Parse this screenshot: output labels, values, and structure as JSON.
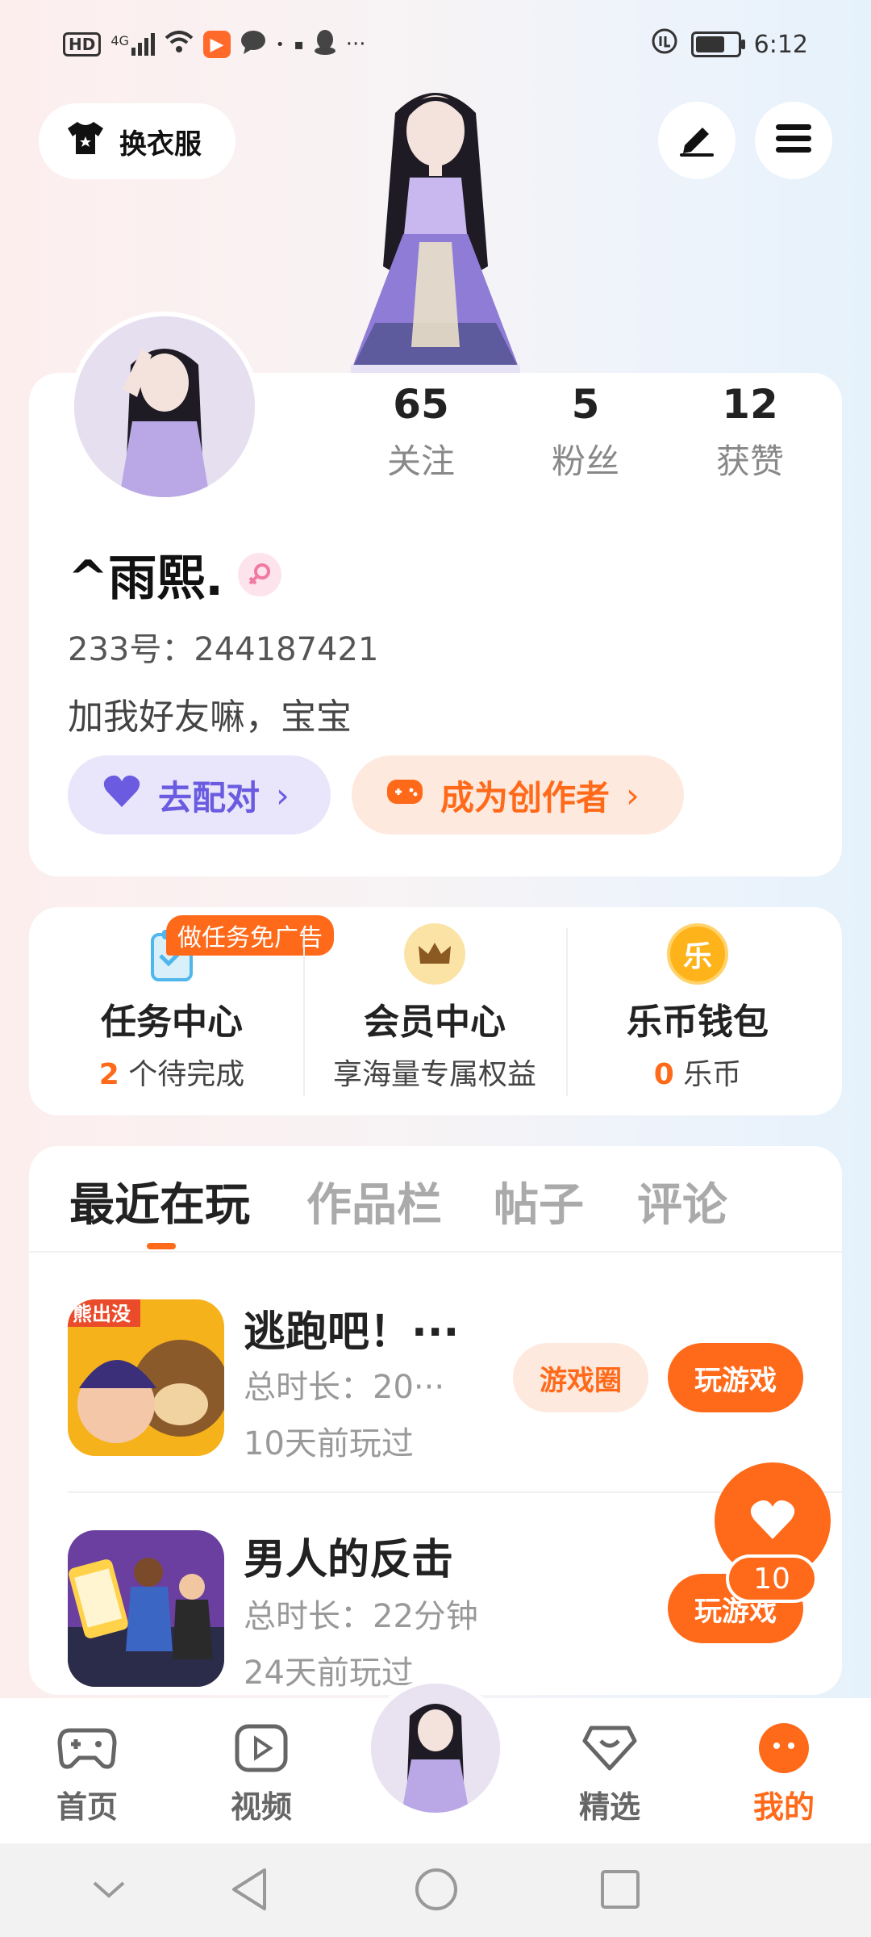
{
  "status_bar": {
    "hd": "HD",
    "network": "4G",
    "more": "···",
    "time": "6:12",
    "battery_level": 0.7
  },
  "top": {
    "outfit_label": "换衣服"
  },
  "profile": {
    "stats": [
      {
        "value": "65",
        "label": "关注"
      },
      {
        "value": "5",
        "label": "粉丝"
      },
      {
        "value": "12",
        "label": "获赞"
      }
    ],
    "nickname": "^雨熙.",
    "uid": "233号：244187421",
    "bio": "加我好友嘛，宝宝",
    "pair_label": "去配对",
    "creator_label": "成为创作者"
  },
  "services": {
    "task_tag": "做任务免广告",
    "items": [
      {
        "title": "任务中心",
        "count": "2",
        "sub": " 个待完成"
      },
      {
        "title": "会员中心",
        "sub": "享海量专属权益"
      },
      {
        "title": "乐币钱包",
        "count": "0",
        "sub": " 乐币",
        "icon_text": "乐"
      }
    ]
  },
  "tabs": [
    "最近在玩",
    "作品栏",
    "帖子",
    "评论"
  ],
  "games": [
    {
      "title": "逃跑吧！···",
      "duration": "总时长：20···",
      "last_played": "10天前玩过",
      "thumb_text": "熊出没",
      "community_label": "游戏圈",
      "play_label": "玩游戏"
    },
    {
      "title": "男人的反击",
      "duration": "总时长：22分钟",
      "last_played": "24天前玩过",
      "play_label": "玩游戏"
    }
  ],
  "fab": {
    "count": "10"
  },
  "bottom_nav": [
    "首页",
    "视频",
    "精选",
    "我的"
  ],
  "colors": {
    "accent": "#ff6a1a",
    "pair_bg": "#e9e6fb",
    "pair_fg": "#6a5be0",
    "creator_bg": "#fee9de"
  }
}
